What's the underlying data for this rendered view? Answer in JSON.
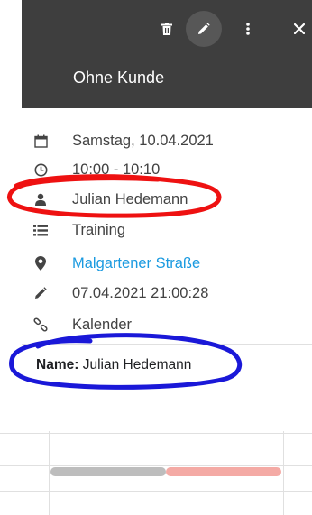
{
  "header": {
    "title": "Ohne Kunde",
    "background": "#3e3e3e",
    "actions": [
      {
        "name": "delete-icon"
      },
      {
        "name": "edit-icon"
      },
      {
        "name": "more-icon"
      },
      {
        "name": "close-icon"
      }
    ]
  },
  "details": {
    "date": "Samstag, 10.04.2021",
    "time": "10:00 - 10:10",
    "person": "Julian Hedemann",
    "category": "Training",
    "location": "Malgartener Straße",
    "modified": "07.04.2021 21:00:28",
    "calendar": "Kalender"
  },
  "description": {
    "label": "Name:",
    "value": "Julian Hedemann"
  },
  "colors": {
    "link": "#1a9ae0",
    "annotation_red": "#ee1111",
    "annotation_blue": "#1a18d8",
    "event_gray": "#bdbdbd",
    "event_pink": "#f4aaa5"
  }
}
